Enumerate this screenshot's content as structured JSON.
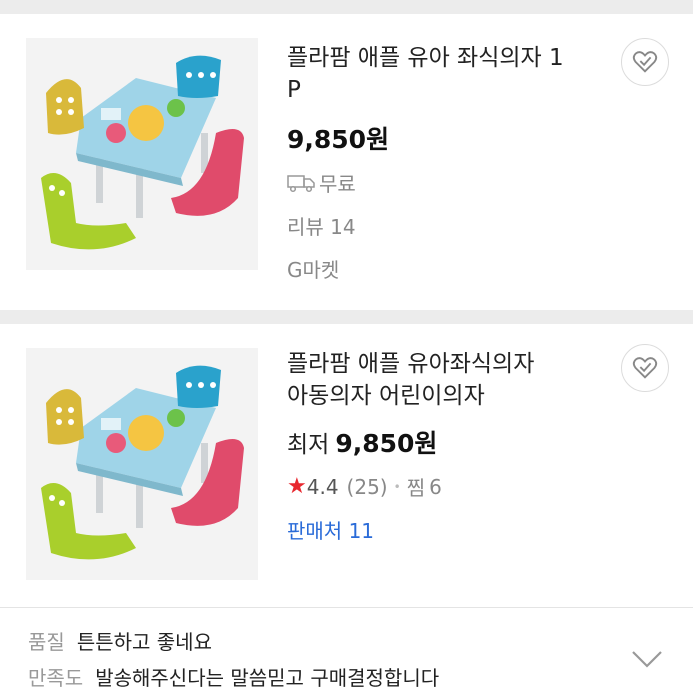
{
  "products": [
    {
      "title_line1": "플라팜 애플 유아 좌식의자 1",
      "title_line2": "P",
      "price": "9,850",
      "currency": "원",
      "shipping": "무료",
      "review_label": "리뷰",
      "review_count": "14",
      "seller": "G마켓",
      "icon": "heart-check-icon"
    },
    {
      "title_line1": "플라팜 애플 유아좌식의자",
      "title_line2": "아동의자 어린이의자",
      "price_prefix": "최저",
      "price": "9,850",
      "currency": "원",
      "rating": "4.4",
      "rating_count": "(25)",
      "dot": "•",
      "wish_label": "찜",
      "wish_count": "6",
      "stores_label": "판매처",
      "stores_count": "11",
      "icon": "heart-check-icon"
    }
  ],
  "reviews": [
    {
      "label": "품질",
      "text": "튼튼하고 좋네요"
    },
    {
      "label": "만족도",
      "text": "발송해주신다는 말씀믿고 구매결정합니다"
    }
  ],
  "colors": {
    "accent_blue": "#2a6bd8",
    "star_red": "#e8282f"
  }
}
